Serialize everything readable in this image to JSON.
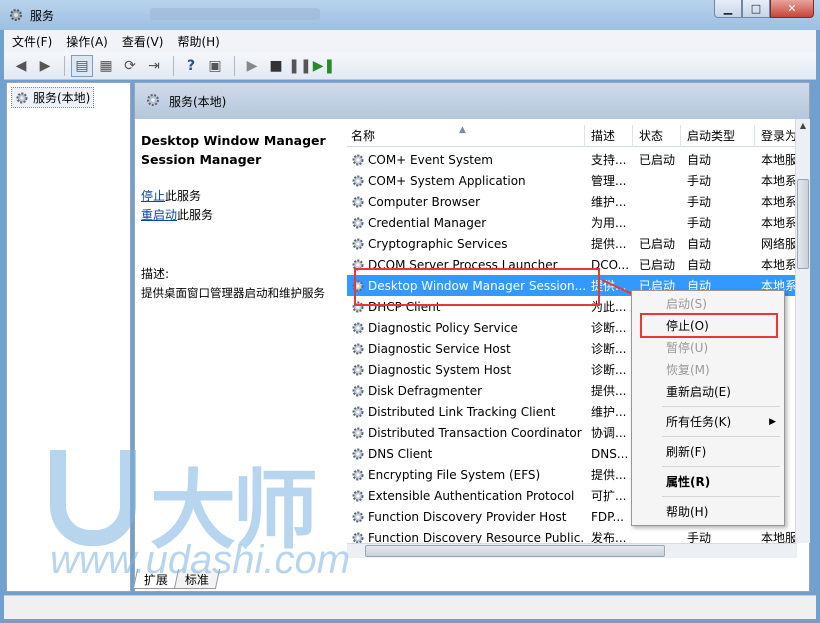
{
  "window": {
    "title": "服务"
  },
  "menu": [
    "文件(F)",
    "操作(A)",
    "查看(V)",
    "帮助(H)"
  ],
  "tree": {
    "root": "服务(本地)"
  },
  "panel": {
    "header": "服务(本地)"
  },
  "description": {
    "service_title": "Desktop Window Manager Session Manager",
    "stop_link": "停止",
    "stop_suffix": "此服务",
    "restart_link": "重启动",
    "restart_suffix": "此服务",
    "label": "描述:",
    "text": "提供桌面窗口管理器启动和维护服务"
  },
  "columns": [
    "名称",
    "描述",
    "状态",
    "启动类型",
    "登录为"
  ],
  "rows": [
    {
      "name": "COM+ Event System",
      "desc": "支持...",
      "status": "已启动",
      "startup": "自动",
      "logon": "本地服"
    },
    {
      "name": "COM+ System Application",
      "desc": "管理...",
      "status": "",
      "startup": "手动",
      "logon": "本地系"
    },
    {
      "name": "Computer Browser",
      "desc": "维护...",
      "status": "",
      "startup": "手动",
      "logon": "本地系"
    },
    {
      "name": "Credential Manager",
      "desc": "为用...",
      "status": "",
      "startup": "手动",
      "logon": "本地系"
    },
    {
      "name": "Cryptographic Services",
      "desc": "提供...",
      "status": "已启动",
      "startup": "自动",
      "logon": "网络服"
    },
    {
      "name": "DCOM Server Process Launcher",
      "desc": "DCO...",
      "status": "已启动",
      "startup": "自动",
      "logon": "本地系"
    },
    {
      "name": "Desktop Window Manager Session...",
      "desc": "提供...",
      "status": "已启动",
      "startup": "自动",
      "logon": "本地系"
    },
    {
      "name": "DHCP Client",
      "desc": "为此...",
      "status": "",
      "startup": "",
      "logon": "服"
    },
    {
      "name": "Diagnostic Policy Service",
      "desc": "诊断...",
      "status": "",
      "startup": "",
      "logon": "服"
    },
    {
      "name": "Diagnostic Service Host",
      "desc": "诊断...",
      "status": "",
      "startup": "",
      "logon": "服"
    },
    {
      "name": "Diagnostic System Host",
      "desc": "诊断...",
      "status": "",
      "startup": "",
      "logon": "系"
    },
    {
      "name": "Disk Defragmenter",
      "desc": "提供...",
      "status": "",
      "startup": "",
      "logon": "系"
    },
    {
      "name": "Distributed Link Tracking Client",
      "desc": "维护...",
      "status": "",
      "startup": "",
      "logon": "系"
    },
    {
      "name": "Distributed Transaction Coordinator",
      "desc": "协调...",
      "status": "",
      "startup": "",
      "logon": "服"
    },
    {
      "name": "DNS Client",
      "desc": "DNS...",
      "status": "",
      "startup": "",
      "logon": "服"
    },
    {
      "name": "Encrypting File System (EFS)",
      "desc": "提供...",
      "status": "",
      "startup": "",
      "logon": "系"
    },
    {
      "name": "Extensible Authentication Protocol",
      "desc": "可扩...",
      "status": "",
      "startup": "",
      "logon": "系"
    },
    {
      "name": "Function Discovery Provider Host",
      "desc": "FDP...",
      "status": "",
      "startup": "",
      "logon": "服"
    },
    {
      "name": "Function Discovery Resource Public...",
      "desc": "发布...",
      "status": "",
      "startup": "手动",
      "logon": "本地服"
    }
  ],
  "context_menu": {
    "start": "启动(S)",
    "stop": "停止(O)",
    "pause": "暂停(U)",
    "resume": "恢复(M)",
    "restart": "重新启动(E)",
    "all_tasks": "所有任务(K)",
    "refresh": "刷新(F)",
    "properties": "属性(R)",
    "help": "帮助(H)"
  },
  "tabs": [
    "扩展",
    "标准"
  ],
  "watermark": {
    "brand": "大师",
    "url": "www.udashi.com"
  },
  "colors": {
    "selection": "#3399ff",
    "highlight": "#e53935",
    "link": "#0645ad"
  }
}
